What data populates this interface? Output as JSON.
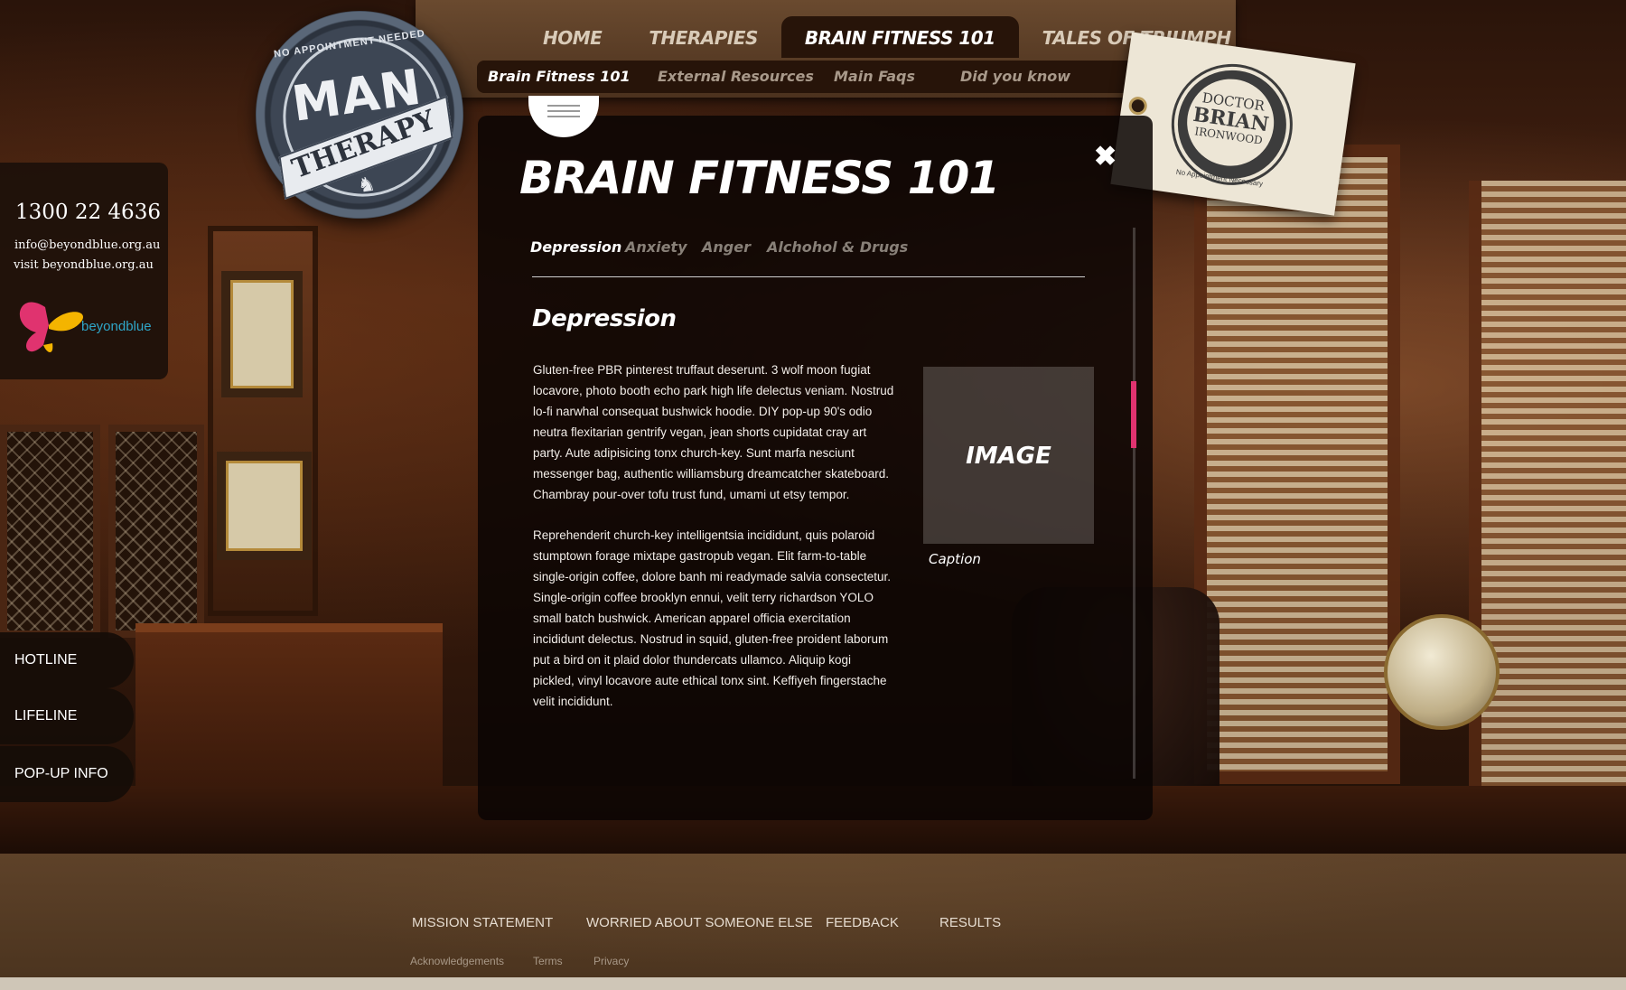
{
  "header": {
    "main_nav": [
      {
        "label": "HOME",
        "active": false
      },
      {
        "label": "THERAPIES",
        "active": false
      },
      {
        "label": "BRAIN FITNESS 101",
        "active": true
      },
      {
        "label": "TALES OF TRIUMPH",
        "active": false
      }
    ],
    "sub_nav": [
      {
        "label": "Brain Fitness 101",
        "active": true
      },
      {
        "label": "External Resources",
        "active": false
      },
      {
        "label": "Main Faqs",
        "active": false
      },
      {
        "label": "Did you know",
        "active": false
      }
    ]
  },
  "logo": {
    "arc_text": "NO APPOINTMENT NEEDED",
    "word1": "MAN",
    "word2": "THERAPY"
  },
  "contact": {
    "phone": "1300 22 4636",
    "email": "info@beyondblue.org.au",
    "visit": "visit beyondblue.org.au",
    "brand": "beyondblue"
  },
  "side_tabs": [
    "HOTLINE",
    "LIFELINE",
    "POP-UP INFO"
  ],
  "tag": {
    "line1": "DOCTOR",
    "line2": "BRIAN",
    "line3": "IRONWOOD",
    "tiny": "No Appointment Necessary"
  },
  "modal": {
    "title": "BRAIN FITNESS 101",
    "close_icon": "close-icon",
    "tabs": [
      {
        "label": "Depression",
        "active": true
      },
      {
        "label": "Anxiety",
        "active": false
      },
      {
        "label": "Anger",
        "active": false
      },
      {
        "label": "Alchohol & Drugs",
        "active": false
      }
    ],
    "section_title": "Depression",
    "paragraph1": "Gluten-free PBR pinterest truffaut deserunt. 3 wolf moon fugiat locavore, photo booth echo park high life delectus veniam. Nostrud lo-fi narwhal consequat bushwick hoodie. DIY pop-up 90's odio neutra flexitarian gentrify vegan, jean shorts cupidatat cray art party. Aute adipisicing tonx church-key. Sunt marfa nesciunt messenger bag, authentic williamsburg dreamcatcher skateboard. Chambray pour-over tofu trust fund, umami ut etsy tempor.",
    "paragraph2": "Reprehenderit church-key intelligentsia incididunt, quis polaroid stumptown forage mixtape gastropub vegan. Elit farm-to-table single-origin coffee, dolore banh mi readymade salvia consectetur. Single-origin coffee brooklyn ennui, velit terry richardson YOLO small batch bushwick. American apparel officia exercitation incididunt delectus. Nostrud in squid, gluten-free proident laborum put a bird on it plaid dolor thundercats ullamco. Aliquip kogi pickled, vinyl locavore aute ethical tonx sint. Keffiyeh fingerstache velit incididunt.",
    "image_label": "IMAGE",
    "caption": "Caption",
    "scroll_color": "#e0336f"
  },
  "footer": {
    "links": [
      "MISSION STATEMENT",
      "WORRIED ABOUT SOMEONE ELSE",
      "FEEDBACK",
      "RESULTS"
    ],
    "small_links": [
      "Acknowledgements",
      "Terms",
      "Privacy"
    ]
  }
}
